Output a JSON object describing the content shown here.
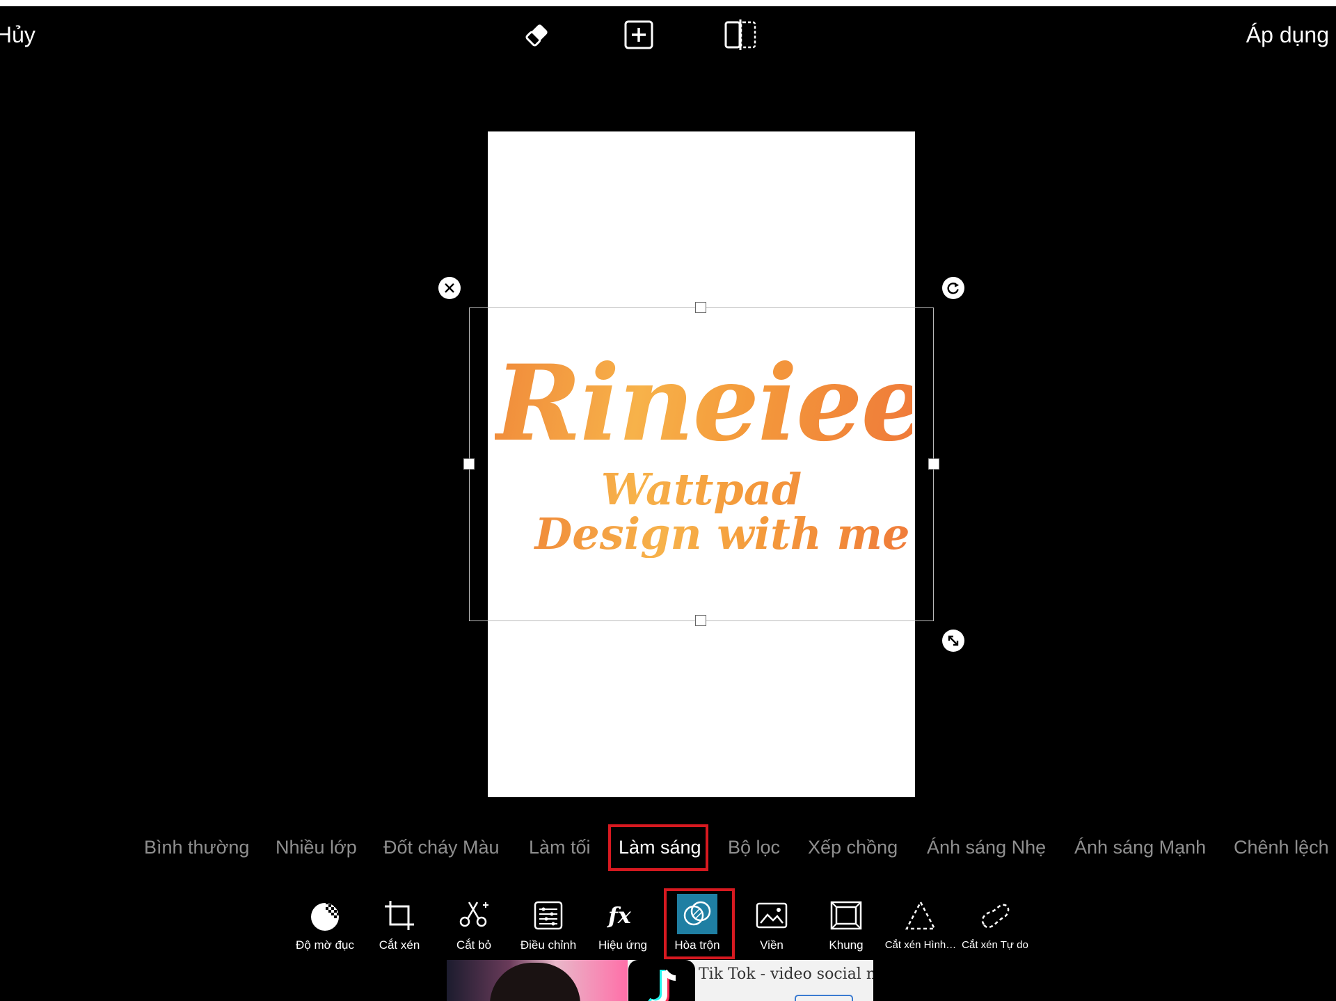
{
  "topbar": {
    "cancel_label": "Hủy",
    "apply_label": "Áp dụng",
    "icons": [
      "eraser-icon",
      "add-layer-icon",
      "compare-icon"
    ]
  },
  "artwork": {
    "title": "Rineiee",
    "line2": "Wattpad",
    "line3": "Design with me"
  },
  "blend_modes": {
    "items": [
      "Bình thường",
      "Nhiều lớp",
      "Đốt cháy Màu",
      "Làm tối",
      "Làm sáng",
      "Bộ lọc",
      "Xếp chồng",
      "Ánh sáng Nhẹ",
      "Ánh sáng Mạnh",
      "Chênh lệch"
    ],
    "selected": "Làm sáng"
  },
  "tools": {
    "items": [
      "Độ mờ đục",
      "Cắt xén",
      "Cắt bỏ",
      "Điều chỉnh",
      "Hiệu ứng",
      "Hòa trộn",
      "Viền",
      "Khung",
      "Cắt xén Hình…",
      "Cắt xén Tự do"
    ],
    "selected": "Hòa trộn"
  },
  "ad": {
    "title": "Tik Tok - video social n…"
  },
  "colors": {
    "highlight_box": "#d71920",
    "selected_tool_bg": "#1f7fa3",
    "inactive_text": "#8f8f8f",
    "artwork_gradient": [
      "#f08a3a",
      "#f7b24a",
      "#ef7a3a"
    ]
  }
}
